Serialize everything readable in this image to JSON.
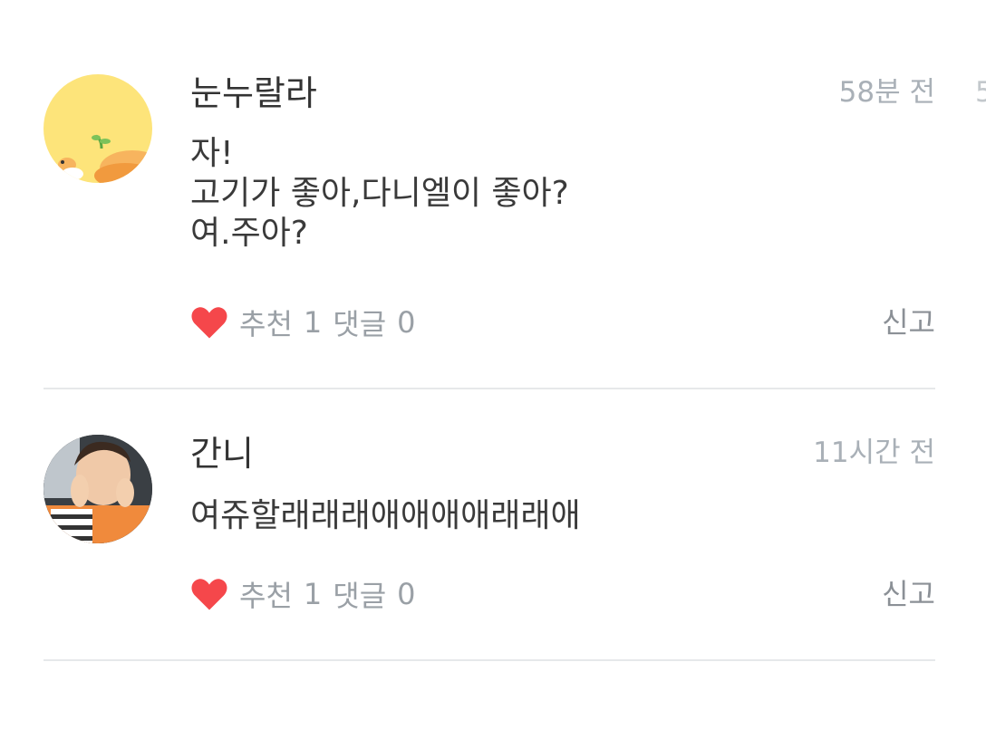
{
  "comments": [
    {
      "author": "눈누랄라",
      "time": "58분 전",
      "lines": [
        "자!",
        "고기가 좋아,다니엘이 좋아?",
        "여.주아?"
      ],
      "like_label": "추천",
      "like_count": "1",
      "reply_label": "댓글",
      "reply_count": "0",
      "report_label": "신고",
      "avatar_icon": "corgi-avatar-icon"
    },
    {
      "author": "간니",
      "time": "11시간 전",
      "lines": [
        "여쥬할래래래애애애애래래애"
      ],
      "like_label": "추천",
      "like_count": "1",
      "reply_label": "댓글",
      "reply_count": "0",
      "report_label": "신고",
      "avatar_icon": "person-photo-avatar"
    }
  ],
  "edge_fragment": "5",
  "colors": {
    "heart": "#f5474b",
    "time": "#a9b0b7",
    "meta": "#9aa0a6",
    "divider": "#e6e8ea",
    "avatar1_bg": "#fde47a"
  }
}
